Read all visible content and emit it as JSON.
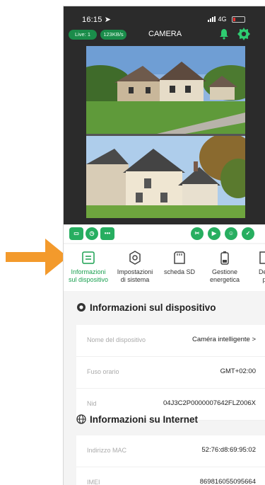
{
  "status_bar": {
    "time": "16:15 ➤",
    "signal": "4G"
  },
  "camera_header": {
    "live_badge": "Live: 1",
    "speed_badge": "123KB/s",
    "title": "CAMERA"
  },
  "controls": {
    "b1": "▭",
    "b2": "◷",
    "b3": "•••",
    "b4": "✂",
    "b5": "▶",
    "b6": "☺",
    "b7": "✓"
  },
  "tabs": [
    {
      "label_line1": "Informazioni",
      "label_line2": "sul dispositivo"
    },
    {
      "label_line1": "Impostazioni",
      "label_line2": "di sistema"
    },
    {
      "label_line1": "scheda SD",
      "label_line2": ""
    },
    {
      "label_line1": "Gestione",
      "label_line2": "energetica"
    },
    {
      "label_line1": "Defi",
      "label_line2": "p"
    }
  ],
  "device_info": {
    "title": "Informazioni sul dispositivo",
    "rows": [
      {
        "key": "Nome del dispositivo",
        "value": "Caméra intelligente >"
      },
      {
        "key": "Fuso orario",
        "value": "GMT+02:00"
      },
      {
        "key": "Nid",
        "value": "04J3C2P0000007642FLZ006X"
      }
    ]
  },
  "internet_info": {
    "title": "Informazioni su Internet",
    "rows": [
      {
        "key": "Indirizzo MAC",
        "value": "52:76:d8:69:95:02"
      },
      {
        "key": "IMEI",
        "value": "869816055095664"
      }
    ]
  },
  "colors": {
    "accent": "#1aa050",
    "arrow": "#f39a2c",
    "camera_bg": "#2b2b2b"
  }
}
